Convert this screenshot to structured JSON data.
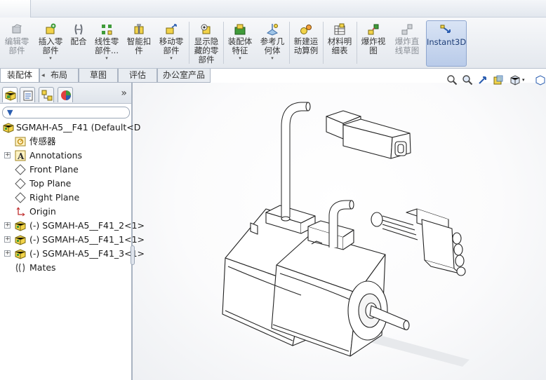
{
  "ribbon": {
    "buttons": [
      {
        "label": "编辑零\n部件",
        "icon": "edit-component-icon",
        "enabled": false
      },
      {
        "label": "插入零\n部件",
        "icon": "insert-component-icon",
        "enabled": true,
        "dropdown": true
      },
      {
        "label": "配合",
        "icon": "mate-icon",
        "enabled": true
      },
      {
        "label": "线性零\n部件...",
        "icon": "linear-pattern-icon",
        "enabled": true,
        "dropdown": true
      },
      {
        "label": "智能扣\n件",
        "icon": "smart-fasteners-icon",
        "enabled": true
      },
      {
        "label": "移动零\n部件",
        "icon": "move-component-icon",
        "enabled": true,
        "dropdown": true
      },
      {
        "label": "显示隐\n藏的零\n部件",
        "icon": "show-hidden-components-icon",
        "enabled": true
      },
      {
        "label": "装配体\n特征",
        "icon": "assembly-features-icon",
        "enabled": true,
        "dropdown": true
      },
      {
        "label": "参考几\n何体",
        "icon": "reference-geometry-icon",
        "enabled": true,
        "dropdown": true
      },
      {
        "label": "新建运\n动算例",
        "icon": "new-motion-study-icon",
        "enabled": true
      },
      {
        "label": "材料明\n细表",
        "icon": "bill-of-materials-icon",
        "enabled": true
      },
      {
        "label": "爆炸视\n图",
        "icon": "exploded-view-icon",
        "enabled": true
      },
      {
        "label": "爆炸直\n线草图",
        "icon": "explode-line-sketch-icon",
        "enabled": false
      },
      {
        "label": "Instant3D",
        "icon": "instant3d-icon",
        "enabled": true,
        "active": true
      }
    ]
  },
  "command_tabs": [
    {
      "label": "装配体",
      "active": true
    },
    {
      "label": "布局",
      "active": false
    },
    {
      "label": "草图",
      "active": false
    },
    {
      "label": "评估",
      "active": false
    },
    {
      "label": "办公室产品",
      "active": false
    }
  ],
  "panel": {
    "collapse_glyph": "»",
    "filter_glyph": "▼",
    "tree": [
      {
        "label": "SGMAH-A5__F41  (Default<D",
        "icon": "assembly-icon",
        "expander": ""
      },
      {
        "label": "传感器",
        "icon": "sensors-folder-icon",
        "expander": ""
      },
      {
        "label": "Annotations",
        "icon": "annotations-icon",
        "expander": "+"
      },
      {
        "label": "Front Plane",
        "icon": "plane-icon",
        "expander": ""
      },
      {
        "label": "Top Plane",
        "icon": "plane-icon",
        "expander": ""
      },
      {
        "label": "Right Plane",
        "icon": "plane-icon",
        "expander": ""
      },
      {
        "label": "Origin",
        "icon": "origin-icon",
        "expander": ""
      },
      {
        "label": "(-) SGMAH-A5__F41_2<1>",
        "icon": "subassembly-icon",
        "expander": "+"
      },
      {
        "label": "(-) SGMAH-A5__F41_1<1>",
        "icon": "subassembly-icon",
        "expander": "+"
      },
      {
        "label": "(-) SGMAH-A5__F41_3<1>",
        "icon": "subassembly-icon",
        "expander": "+"
      },
      {
        "label": "Mates",
        "icon": "mates-folder-icon",
        "expander": ""
      }
    ]
  },
  "colors": {
    "ribbon_bg": "#e4e8ee",
    "accent": "#2a5db0",
    "instant3d_bg": "#b9cbe9"
  }
}
